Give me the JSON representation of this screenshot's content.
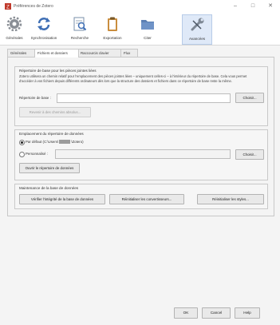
{
  "window": {
    "title": "Préférences de Zotero",
    "controls": {
      "minimize": "–",
      "maximize": "□",
      "close": "✕"
    }
  },
  "toolbar": {
    "items": [
      {
        "label": "Générales",
        "icon": "gear-icon"
      },
      {
        "label": "Synchronisation",
        "icon": "sync-icon"
      },
      {
        "label": "Recherche",
        "icon": "search-icon"
      },
      {
        "label": "Exportation",
        "icon": "clipboard-icon"
      },
      {
        "label": "Citer",
        "icon": "folder-icon"
      },
      {
        "label": "Avancées",
        "icon": "wrench-icon",
        "active": true
      }
    ]
  },
  "tabs": [
    {
      "label": "Générales"
    },
    {
      "label": "Fichiers et dossiers",
      "active": true
    },
    {
      "label": "Raccourcis clavier"
    },
    {
      "label": "Flux"
    }
  ],
  "attachments": {
    "heading": "Répertoire de base pour les pièces jointes liées",
    "description": "Zotero utilisera un chemin relatif pour l'emplacement des pièces jointes liées – uniquement celles-ci – à l'intérieur du répertoire de base. Cela vous permet d'accéder à vos fichiers depuis différents ordinateurs dès lors que la structure des dossiers et fichiers dans ce répertoire de base reste la même.",
    "base_dir_label": "Répertoire de base :",
    "base_dir_value": "",
    "choose_button": "Choisir...",
    "revert_button": "Revenir à des chemins absolus..."
  },
  "data_dir": {
    "heading": "Emplacement du répertoire de données",
    "default_option_prefix": "Par défaut (C:\\Users\\",
    "default_option_suffix": "\\Zotero)",
    "custom_option": "Personnalisé :",
    "custom_value": "",
    "choose_button": "Choisir...",
    "open_button": "Ouvrir le répertoire de données",
    "selected": "default"
  },
  "maintenance": {
    "heading": "Maintenance de la base de données",
    "check_button": "Vérifier l'intégrité de la base de données",
    "reset_translators_button": "Réinitialiser les convertisseurs...",
    "reset_styles_button": "Réinitialiser les styles..."
  },
  "footer": {
    "ok_button": "OK",
    "cancel_button": "Cancel",
    "help_button": "Help"
  }
}
